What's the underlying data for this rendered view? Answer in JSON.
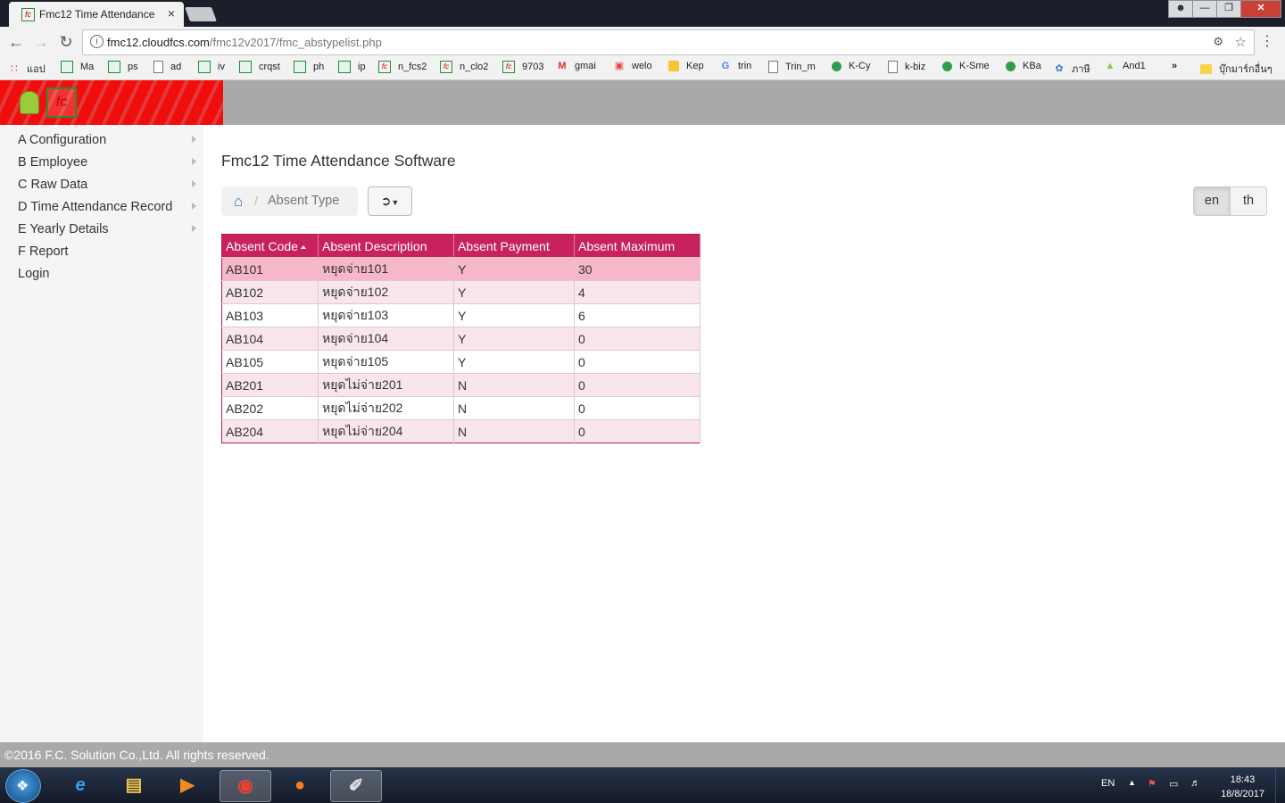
{
  "browser": {
    "tab_title": "Fmc12 Time Attendance",
    "tab_close": "×",
    "url_host": "fmc12.cloudfcs.com",
    "url_path": "/fmc12v2017/fmc_abstypelist.php",
    "bookmarks": [
      "แอป",
      "Ma",
      "ps",
      "ad",
      "iv",
      "crqst",
      "ph",
      "ip",
      "n_fcs2",
      "n_clo2",
      "9703",
      "gmai",
      "welo",
      "Kep",
      "trin",
      "Trin_m",
      "K-Cy",
      "k-biz",
      "K-Sme",
      "KBa",
      "ภาษี",
      "And1"
    ],
    "bookmarks_overflow": "»",
    "bookmarks_other": "บุ๊กมาร์กอื่นๆ"
  },
  "sidebar": {
    "items": [
      {
        "label": "A Configuration",
        "has_submenu": true
      },
      {
        "label": "B Employee",
        "has_submenu": true
      },
      {
        "label": "C Raw Data",
        "has_submenu": true
      },
      {
        "label": "D Time Attendance Record",
        "has_submenu": true
      },
      {
        "label": "E Yearly Details",
        "has_submenu": true
      },
      {
        "label": "F Report",
        "has_submenu": false
      },
      {
        "label": "Login",
        "has_submenu": false
      }
    ]
  },
  "main": {
    "title": "Fmc12 Time Attendance Software",
    "breadcrumb": {
      "separator": "/",
      "current": "Absent Type"
    },
    "languages": [
      "en",
      "th"
    ],
    "active_language": "en",
    "table": {
      "columns": [
        "Absent Code",
        "Absent Description",
        "Absent Payment",
        "Absent Maximum"
      ],
      "sorted_column": "Absent Code",
      "rows": [
        [
          "AB101",
          "หยุดจ่าย101",
          "Y",
          "30"
        ],
        [
          "AB102",
          "หยุดจ่าย102",
          "Y",
          "4"
        ],
        [
          "AB103",
          "หยุดจ่าย103",
          "Y",
          "6"
        ],
        [
          "AB104",
          "หยุดจ่าย104",
          "Y",
          "0"
        ],
        [
          "AB105",
          "หยุดจ่าย105",
          "Y",
          "0"
        ],
        [
          "AB201",
          "หยุดไม่จ่าย201",
          "N",
          "0"
        ],
        [
          "AB202",
          "หยุดไม่จ่าย202",
          "N",
          "0"
        ],
        [
          "AB204",
          "หยุดไม่จ่าย204",
          "N",
          "0"
        ]
      ],
      "selected_row": 0
    }
  },
  "footer": {
    "text": "©2016 F.C. Solution Co.,Ltd. All rights reserved."
  },
  "taskbar": {
    "language": "EN",
    "time": "18:43",
    "date": "18/8/2017"
  },
  "colors": {
    "header_red": "#f10d0d",
    "header_gray": "#a9a9a9",
    "table_header": "#c7215f",
    "row_selected": "#f6b7c8",
    "row_alt": "#f9e6ec"
  }
}
